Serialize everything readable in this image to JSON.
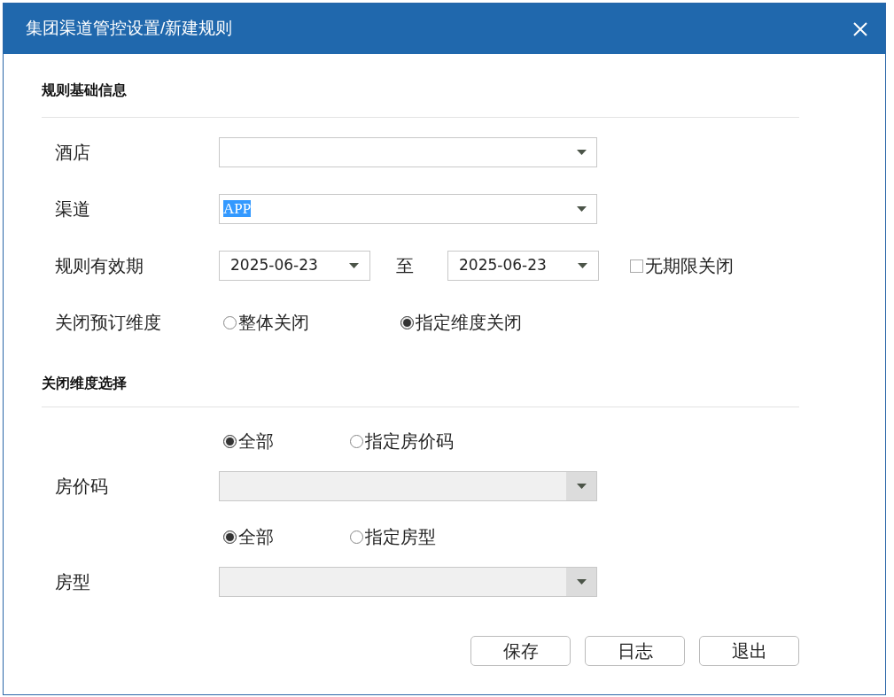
{
  "dialog": {
    "title": "集团渠道管控设置/新建规则"
  },
  "sections": [
    {
      "title": "规则基础信息",
      "fields": [
        {
          "kind": "select",
          "label": "酒店",
          "disabled": false
        },
        {
          "kind": "select",
          "label": "渠道",
          "value": "APP",
          "disabled": false,
          "highlighted": true
        },
        {
          "kind": "date_range",
          "label": "规则有效期",
          "from": "2025-06-23",
          "separator": "至",
          "to": "2025-06-23",
          "checkbox": {
            "label": "无期限关闭",
            "checked": false
          }
        },
        {
          "kind": "radio_group",
          "label": "关闭预订维度",
          "options": [
            {
              "label": "整体关闭",
              "selected": false
            },
            {
              "label": "指定维度关闭",
              "selected": true
            }
          ]
        }
      ]
    },
    {
      "title": "关闭维度选择",
      "fields": [
        {
          "kind": "radio_group",
          "options": [
            {
              "label": "全部",
              "selected": true
            },
            {
              "label": "指定房价码",
              "selected": false
            }
          ]
        },
        {
          "kind": "select",
          "label": "房价码",
          "disabled": true
        },
        {
          "kind": "radio_group",
          "options": [
            {
              "label": "全部",
              "selected": true
            },
            {
              "label": "指定房型",
              "selected": false
            }
          ]
        },
        {
          "kind": "select",
          "label": "房型",
          "disabled": true
        }
      ]
    }
  ],
  "buttons": [
    "保存",
    "日志",
    "退出"
  ]
}
